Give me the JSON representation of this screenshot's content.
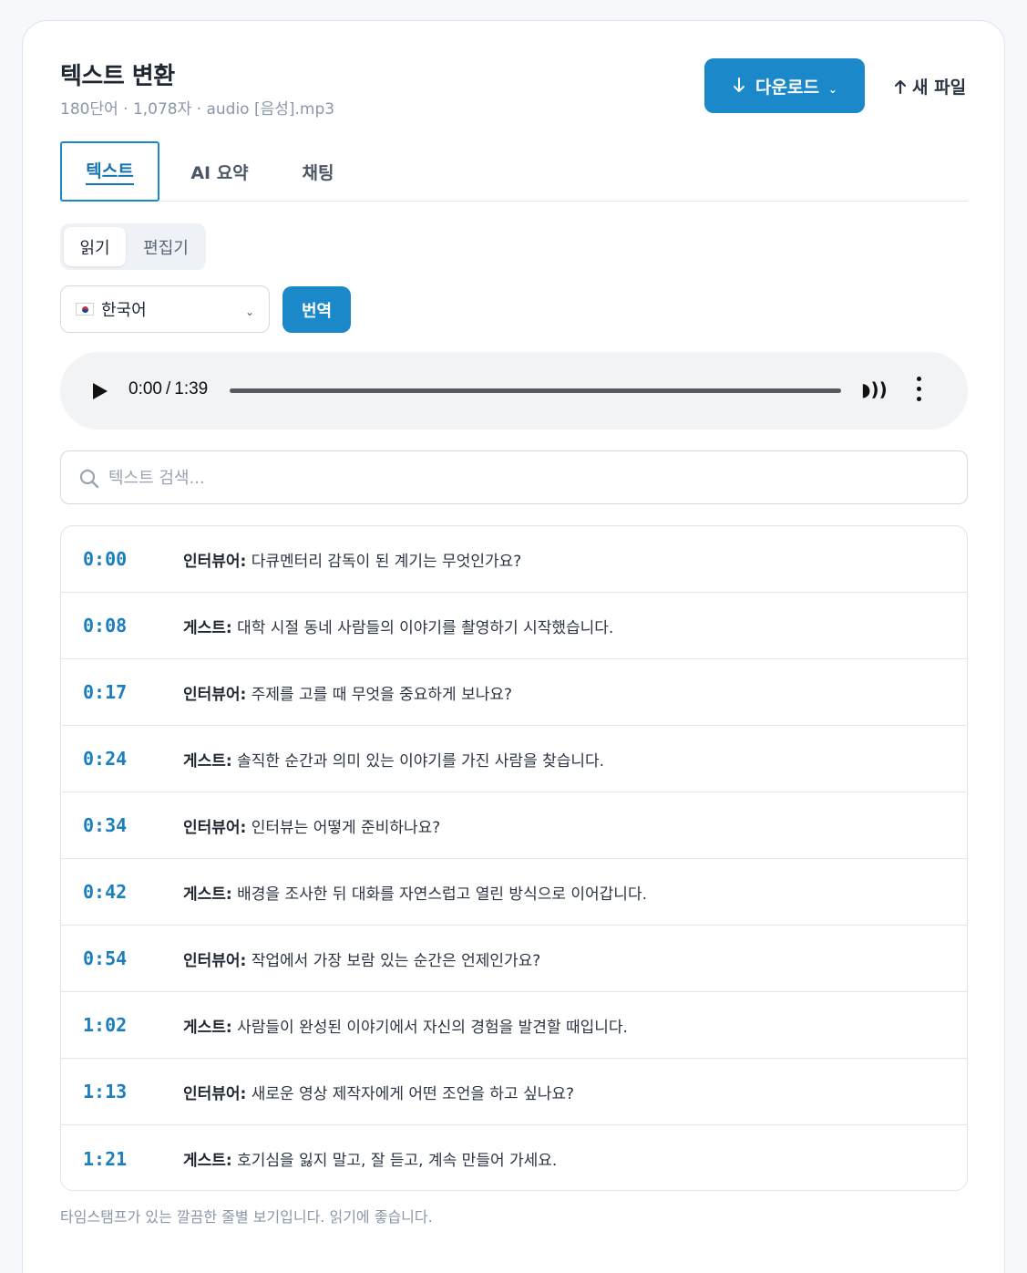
{
  "header": {
    "title": "텍스트 변환",
    "meta": "180단어 · 1,078자 · audio [음성].mp3",
    "download_label": "다운로드",
    "newfile_label": "새 파일"
  },
  "tabs": [
    {
      "label": "텍스트",
      "active": true
    },
    {
      "label": "AI 요약",
      "active": false
    },
    {
      "label": "채팅",
      "active": false
    }
  ],
  "view_toggle": {
    "read_label": "읽기",
    "edit_label": "편집기",
    "selected": "읽기"
  },
  "language": {
    "selected": "한국어",
    "flag_icon": "korea-flag-icon"
  },
  "translate_label": "번역",
  "player": {
    "current_time": "0:00",
    "duration": "1:39",
    "separator": "/",
    "progress_fraction": 0
  },
  "search": {
    "placeholder": "텍스트 검색..."
  },
  "transcript": [
    {
      "time": "0:00",
      "speaker": "인터뷰어:",
      "text": " 다큐멘터리 감독이 된 계기는 무엇인가요?"
    },
    {
      "time": "0:08",
      "speaker": "게스트:",
      "text": " 대학 시절 동네 사람들의 이야기를 촬영하기 시작했습니다."
    },
    {
      "time": "0:17",
      "speaker": "인터뷰어:",
      "text": " 주제를 고를 때 무엇을 중요하게 보나요?"
    },
    {
      "time": "0:24",
      "speaker": "게스트:",
      "text": " 솔직한 순간과 의미 있는 이야기를 가진 사람을 찾습니다."
    },
    {
      "time": "0:34",
      "speaker": "인터뷰어:",
      "text": " 인터뷰는 어떻게 준비하나요?"
    },
    {
      "time": "0:42",
      "speaker": "게스트:",
      "text": " 배경을 조사한 뒤 대화를 자연스럽고 열린 방식으로 이어갑니다."
    },
    {
      "time": "0:54",
      "speaker": "인터뷰어:",
      "text": " 작업에서 가장 보람 있는 순간은 언제인가요?"
    },
    {
      "time": "1:02",
      "speaker": "게스트:",
      "text": " 사람들이 완성된 이야기에서 자신의 경험을 발견할 때입니다."
    },
    {
      "time": "1:13",
      "speaker": "인터뷰어:",
      "text": " 새로운 영상 제작자에게 어떤 조언을 하고 싶나요?"
    },
    {
      "time": "1:21",
      "speaker": "게스트:",
      "text": " 호기심을 잃지 말고, 잘 듣고, 계속 만들어 가세요."
    }
  ],
  "footnote": "타임스탬프가 있는 깔끔한 줄별 보기입니다. 읽기에 좋습니다.",
  "colors": {
    "accent": "#1b88c9",
    "timestamp": "#1b7fbf",
    "muted_text": "#8a97a8"
  }
}
